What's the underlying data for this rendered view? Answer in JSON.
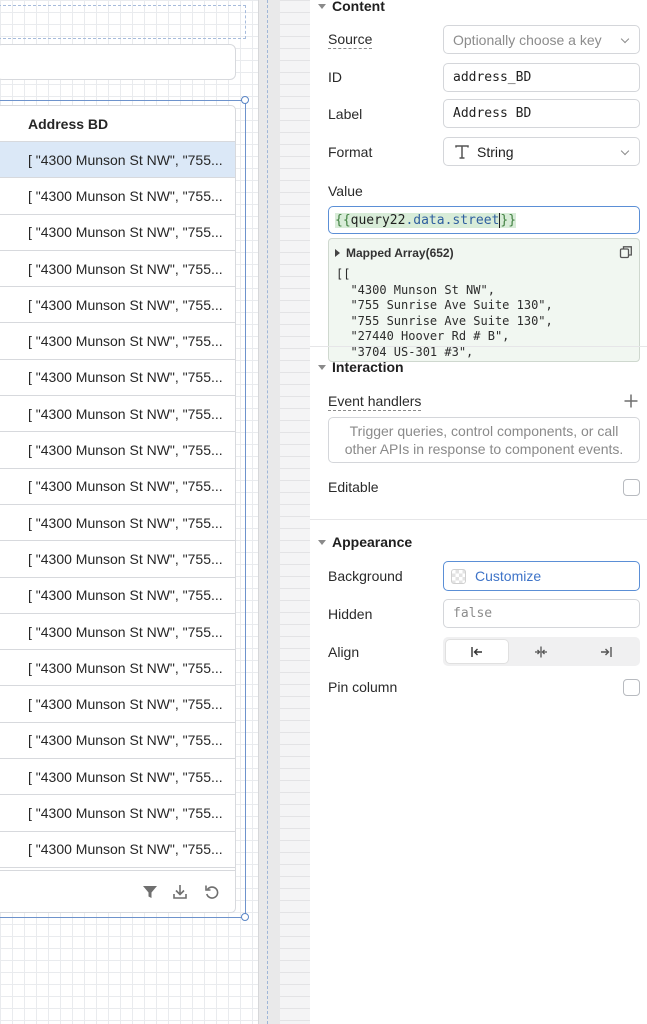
{
  "table": {
    "header": "Address BD",
    "rows": [
      "[ \"4300 Munson St NW\", \"755...",
      "[ \"4300 Munson St NW\", \"755...",
      "[ \"4300 Munson St NW\", \"755...",
      "[ \"4300 Munson St NW\", \"755...",
      "[ \"4300 Munson St NW\", \"755...",
      "[ \"4300 Munson St NW\", \"755...",
      "[ \"4300 Munson St NW\", \"755...",
      "[ \"4300 Munson St NW\", \"755...",
      "[ \"4300 Munson St NW\", \"755...",
      "[ \"4300 Munson St NW\", \"755...",
      "[ \"4300 Munson St NW\", \"755...",
      "[ \"4300 Munson St NW\", \"755...",
      "[ \"4300 Munson St NW\", \"755...",
      "[ \"4300 Munson St NW\", \"755...",
      "[ \"4300 Munson St NW\", \"755...",
      "[ \"4300 Munson St NW\", \"755...",
      "[ \"4300 Munson St NW\", \"755...",
      "[ \"4300 Munson St NW\", \"755...",
      "[ \"4300 Munson St NW\", \"755...",
      "[ \"4300 Munson St NW\", \"755..."
    ],
    "selected_row_index": 0,
    "footer_icons": [
      "filter-icon",
      "download-icon",
      "refresh-icon"
    ]
  },
  "inspector": {
    "content": {
      "title": "Content",
      "source_label": "Source",
      "source_placeholder": "Optionally choose a key",
      "id_label": "ID",
      "id_value": "address_BD",
      "label_label": "Label",
      "label_value": "Address BD",
      "format_label": "Format",
      "format_value": "String",
      "value_label": "Value",
      "value_expression": {
        "open": "{{",
        "ident": "query22",
        "prop": ".data.street",
        "close": "}}"
      },
      "preview": {
        "title": "Mapped Array(652)",
        "lines": [
          "[[",
          "  \"4300 Munson St NW\",",
          "  \"755 Sunrise Ave Suite 130\",",
          "  \"755 Sunrise Ave Suite 130\",",
          "  \"27440 Hoover Rd # B\",",
          "  \"3704 US-301 #3\","
        ]
      }
    },
    "interaction": {
      "title": "Interaction",
      "event_handlers_label": "Event handlers",
      "event_handlers_placeholder": "Trigger queries, control components, or call other APIs in response to component events.",
      "editable_label": "Editable",
      "editable_checked": false
    },
    "appearance": {
      "title": "Appearance",
      "background_label": "Background",
      "background_value": "Customize",
      "hidden_label": "Hidden",
      "hidden_value": "false",
      "align_label": "Align",
      "align_options": [
        "align-left-icon",
        "align-center-icon",
        "align-right-icon"
      ],
      "align_selected": 0,
      "pin_column_label": "Pin column",
      "pin_column_checked": false
    }
  },
  "colors": {
    "accent": "#5b8fd6",
    "selection": "#dbe8f7",
    "preview_bg": "#f1f7f1"
  }
}
